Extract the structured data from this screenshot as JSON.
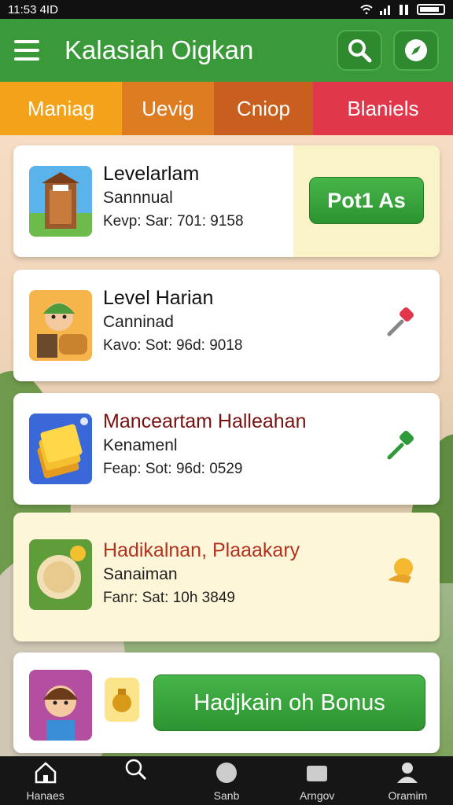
{
  "status_bar": {
    "time": "11:53 4ID"
  },
  "header": {
    "title": "Kalasiah Oigkan"
  },
  "tabs": [
    {
      "label": "Maniag",
      "color": "#f5a21b"
    },
    {
      "label": "Uevig",
      "color": "#de7c22"
    },
    {
      "label": "Cniop",
      "color": "#c95f1e"
    },
    {
      "label": "Blaniels",
      "color": "#e0384a"
    }
  ],
  "cards": [
    {
      "title": "Levelarlam",
      "subtitle": "Sannnual",
      "meta": "Kevp: Sar: 701: 9158",
      "action": "Pot1 As"
    },
    {
      "title": "Level Harian",
      "subtitle": "Canninad",
      "meta": "Kavo: Sot: 96d: 9018"
    },
    {
      "title": "Manceartam Halleahan",
      "subtitle": "Kenamenl",
      "meta": "Feap: Sot: 96d: 0529"
    },
    {
      "title": "Hadikalnan, Plaaakary",
      "subtitle": "Sanaiman",
      "meta": "Fanr: Sat: 10h 3849"
    }
  ],
  "bonus": {
    "button_label": "Hadjkain oh Bonus"
  },
  "bottom_nav": [
    {
      "label": "Hanaes",
      "icon": "home-icon"
    },
    {
      "label": "",
      "icon": "search-icon"
    },
    {
      "label": "Sanb",
      "icon": "circle-icon"
    },
    {
      "label": "Arngov",
      "icon": "folder-icon"
    },
    {
      "label": "Oramim",
      "icon": "profile-icon"
    }
  ],
  "colors": {
    "header": "#3a9a3a",
    "accent_green": "#2c9330",
    "title_red": "#c0392b"
  }
}
